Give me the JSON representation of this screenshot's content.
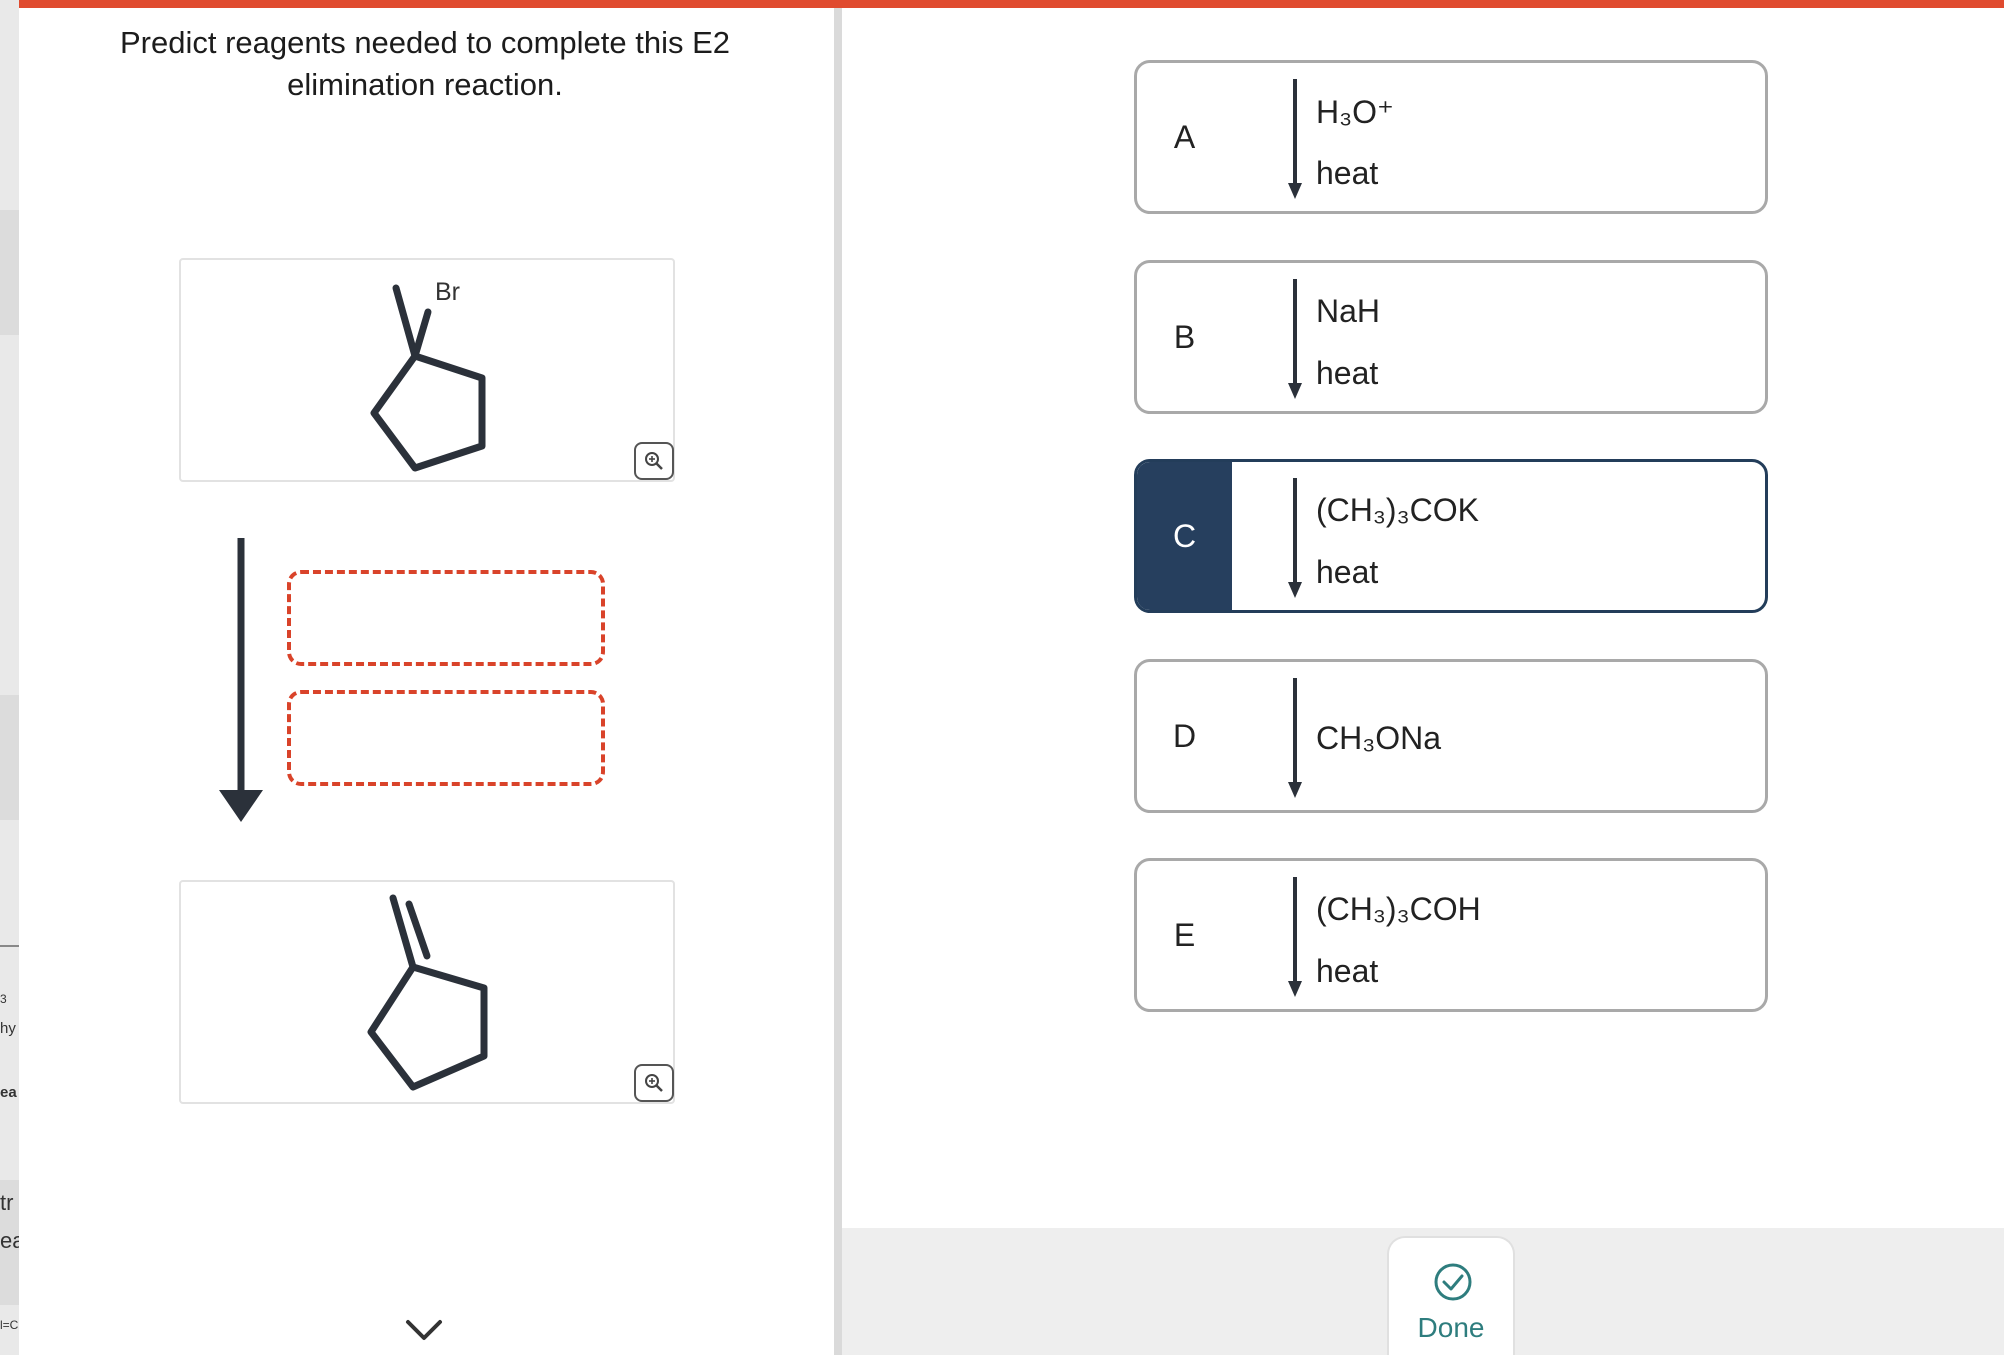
{
  "question": "Predict reagents needed to complete this E2 elimination reaction.",
  "reactant": {
    "atom_label": "Br"
  },
  "options": [
    {
      "letter": "A",
      "line1": "H₃O⁺",
      "line2": "heat",
      "selected": false
    },
    {
      "letter": "B",
      "line1": "NaH",
      "line2": "heat",
      "selected": false
    },
    {
      "letter": "C",
      "line1": "(CH₃)₃COK",
      "line2": "heat",
      "selected": true
    },
    {
      "letter": "D",
      "line1": "CH₃ONa",
      "line2": "",
      "selected": false
    },
    {
      "letter": "E",
      "line1": "(CH₃)₃COH",
      "line2": "heat",
      "selected": false
    }
  ],
  "done_label": "Done",
  "background_fragments": [
    "3",
    "hy",
    "ea",
    "tr",
    "ea",
    "l=C"
  ],
  "colors": {
    "accent_bar": "#e04b2f",
    "dropzone_border": "#d9432a",
    "selected_option": "#263f5e",
    "done": "#2e7d7e",
    "molecule": "#2b313a"
  }
}
